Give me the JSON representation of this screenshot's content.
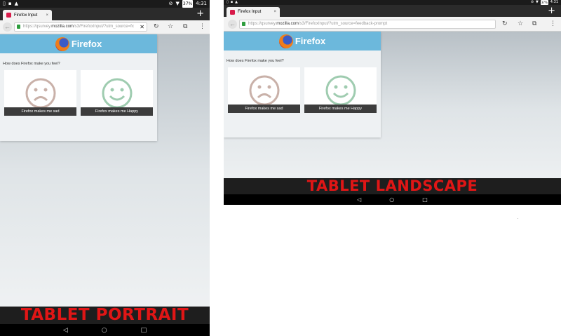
{
  "status_bar": {
    "time": "4:31",
    "battery": "37%",
    "icons": [
      "sim-icon",
      "notification-icon",
      "warning-icon",
      "dnd-icon",
      "wifi-icon",
      "battery-icon"
    ]
  },
  "tab": {
    "title": "Firefox Input",
    "close": "×",
    "new_tab": "+"
  },
  "portrait": {
    "url_prefix": "https://qsurvey.",
    "url_domain": "mozilla.com",
    "url_suffix": "/s3/FirefoxInput/?utm_source=fx",
    "clear": "✕"
  },
  "landscape": {
    "url_prefix": "https://qsurvey.",
    "url_domain": "mozilla.com",
    "url_suffix": "/s3/FirefoxInput/?utm_source=feedback-prompt"
  },
  "toolbar": {
    "reload": "↻",
    "star": "☆",
    "tabs": "⧉",
    "menu": "⋮"
  },
  "survey": {
    "brand": "Firefox",
    "question": "How does Firefox make you feel?",
    "sad_label": "Firefox makes me sad",
    "happy_label": "Firefox makes me Happy",
    "sad_color": "#c9b1a9",
    "happy_color": "#9fccb0"
  },
  "captions": {
    "portrait": "TABLET PORTRAIT",
    "landscape": "TABLET LANDSCAPE"
  },
  "nav": {
    "back": "◁",
    "home": "○",
    "recents": "□"
  }
}
